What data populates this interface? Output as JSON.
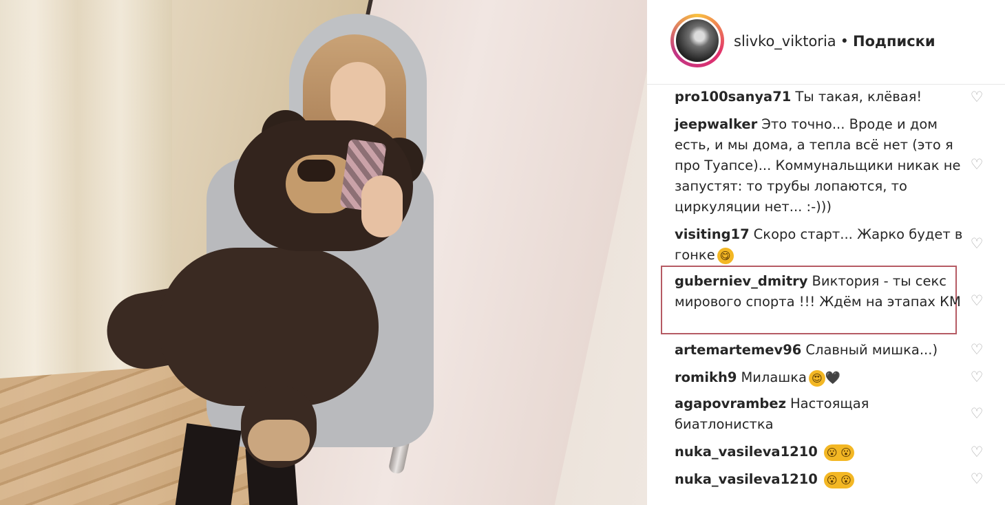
{
  "post": {
    "photo_alt": "mirror selfie with teddy bear"
  },
  "header": {
    "username": "slivko_viktoria",
    "separator": "•",
    "follow_label": "Подписки"
  },
  "comments": [
    {
      "user": "pro100sanya71",
      "text": "Ты такая, клёвая!"
    },
    {
      "user": "jeepwalker",
      "text": "Это точно... Вроде и дом есть, и мы дома, а тепла всё нет (это я про Туапсе)... Коммунальщики никак не запустят: то трубы лопаются, то циркуляции нет... :-)))"
    },
    {
      "user": "visiting17",
      "text": "Скоро старт... Жарко будет в гонке",
      "emoji": "😋"
    },
    {
      "user": "guberniev_dmitry",
      "text": "Виктория - ты секс мирового спорта !!! Ждём на этапах КМ",
      "highlighted": true
    },
    {
      "user": "artemartemev96",
      "text": "Славный мишка...)"
    },
    {
      "user": "romikh9",
      "text": "Милашка",
      "emoji": "😍",
      "extra": "🖤"
    },
    {
      "user": "agapovrambez",
      "text": "Настоящая биатлонистка"
    },
    {
      "user": "nuka_vasileva1210",
      "text": "",
      "emoji": "😮 😮"
    },
    {
      "user": "nuka_vasileva1210",
      "text": "",
      "emoji": "😮 😮"
    }
  ],
  "icons": {
    "like": "heart-outline-icon"
  }
}
